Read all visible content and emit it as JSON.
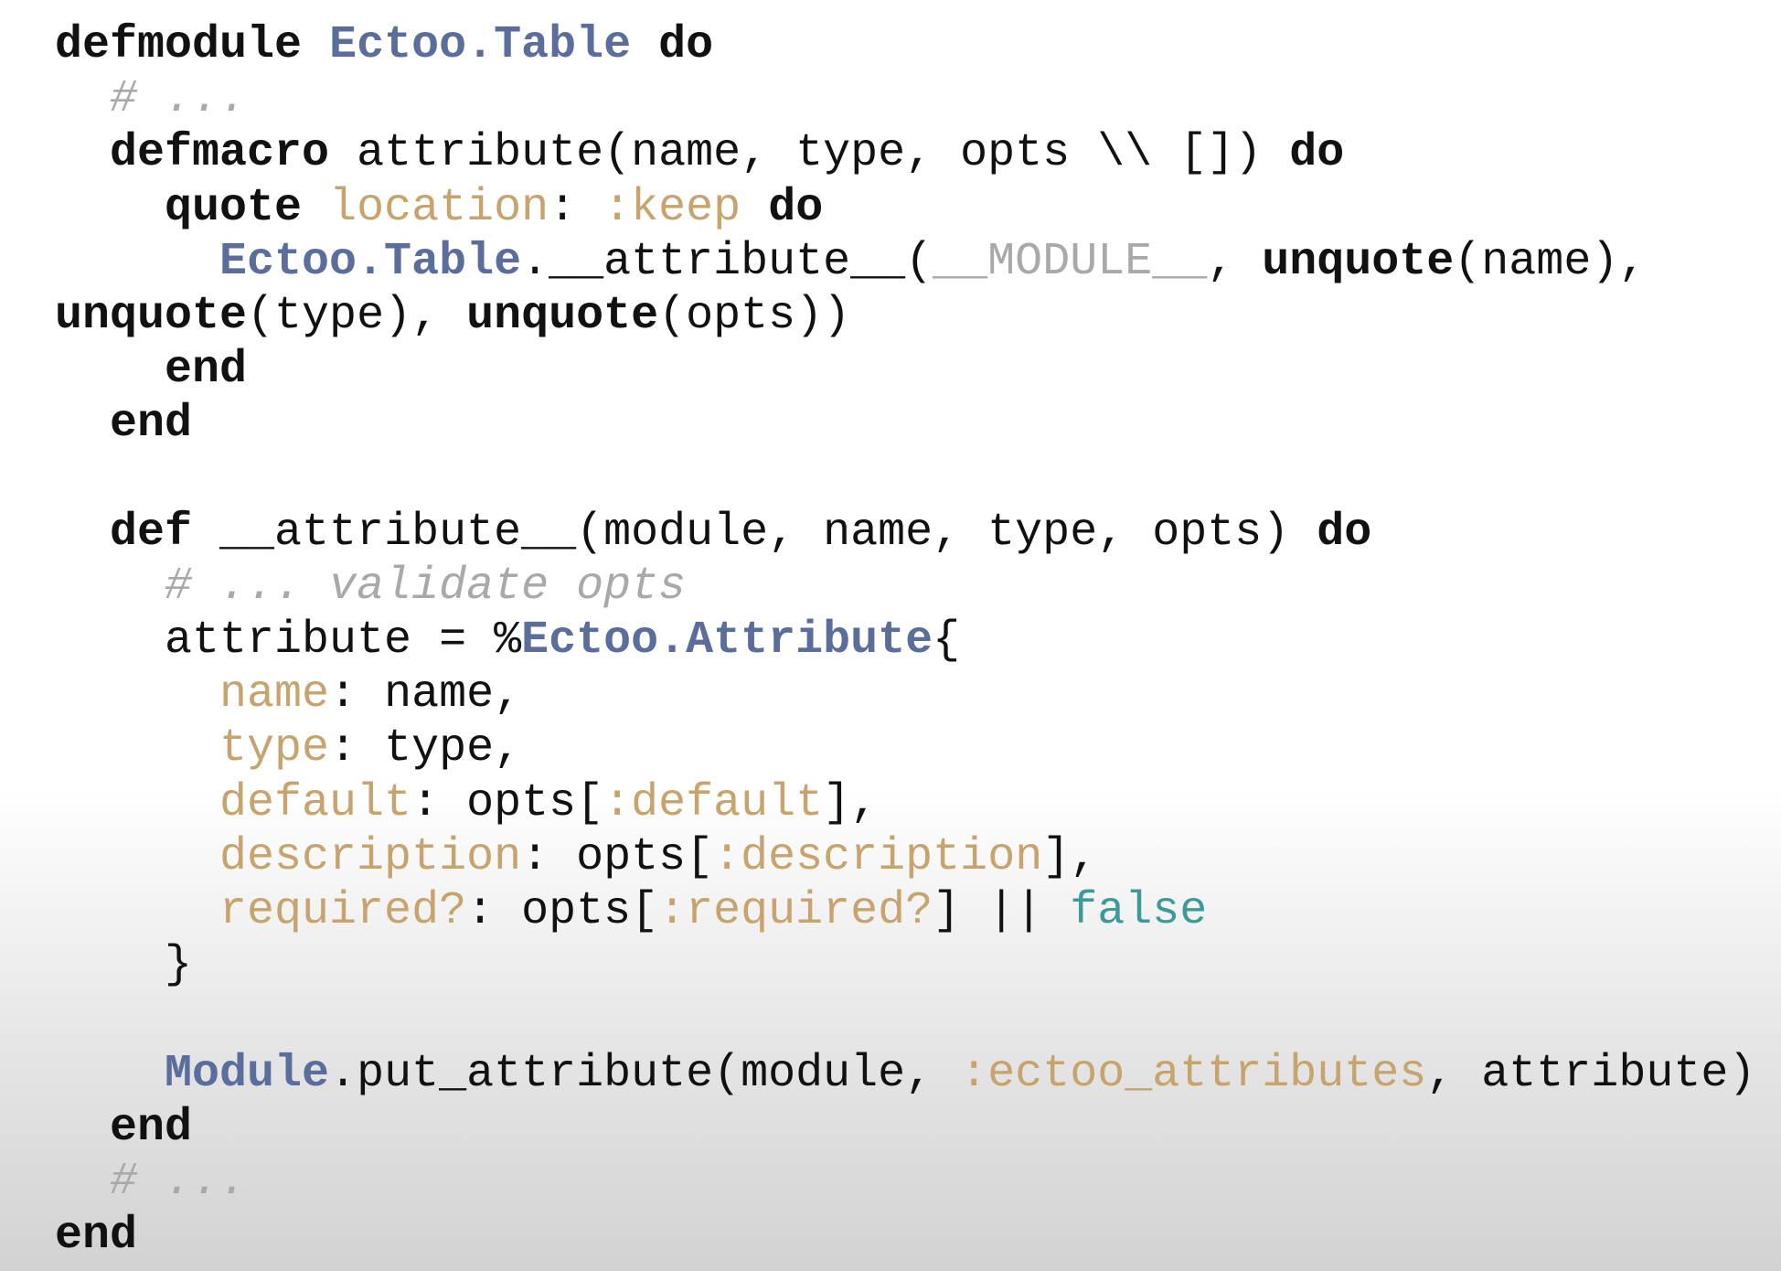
{
  "slide": {
    "language": "Elixir",
    "colors": {
      "background": "#ffffff",
      "keyword": "#111111",
      "module": "#5b6d9a",
      "atom": "#c7a36e",
      "comment": "#a9a9a9",
      "boolean": "#3d9a9b"
    },
    "lines": [
      [
        [
          "keyword",
          "defmodule"
        ],
        [
          "plain",
          " "
        ],
        [
          "module",
          "Ectoo.Table"
        ],
        [
          "plain",
          " "
        ],
        [
          "keyword",
          "do"
        ]
      ],
      [
        [
          "plain",
          "  "
        ],
        [
          "comment",
          "# ..."
        ]
      ],
      [
        [
          "plain",
          "  "
        ],
        [
          "keyword",
          "defmacro"
        ],
        [
          "plain",
          " attribute(name, type, opts \\\\ []) "
        ],
        [
          "keyword",
          "do"
        ]
      ],
      [
        [
          "plain",
          "    "
        ],
        [
          "keyword",
          "quote"
        ],
        [
          "plain",
          " "
        ],
        [
          "atom",
          "location"
        ],
        [
          "plain",
          ": "
        ],
        [
          "atom",
          ":keep"
        ],
        [
          "plain",
          " "
        ],
        [
          "keyword",
          "do"
        ]
      ],
      [
        [
          "plain",
          "      "
        ],
        [
          "module",
          "Ectoo.Table"
        ],
        [
          "plain",
          ".__attribute__("
        ],
        [
          "dim",
          "__MODULE__"
        ],
        [
          "plain",
          ", "
        ],
        [
          "keyword",
          "unquote"
        ],
        [
          "plain",
          "(name),"
        ]
      ],
      [
        [
          "keyword",
          "unquote"
        ],
        [
          "plain",
          "(type), "
        ],
        [
          "keyword",
          "unquote"
        ],
        [
          "plain",
          "(opts))"
        ]
      ],
      [
        [
          "plain",
          "    "
        ],
        [
          "keyword",
          "end"
        ]
      ],
      [
        [
          "plain",
          "  "
        ],
        [
          "keyword",
          "end"
        ]
      ],
      [],
      [
        [
          "plain",
          "  "
        ],
        [
          "keyword",
          "def"
        ],
        [
          "plain",
          " __attribute__(module, name, type, opts) "
        ],
        [
          "keyword",
          "do"
        ]
      ],
      [
        [
          "plain",
          "    "
        ],
        [
          "comment",
          "# ... validate opts"
        ]
      ],
      [
        [
          "plain",
          "    attribute = %"
        ],
        [
          "module",
          "Ectoo.Attribute"
        ],
        [
          "plain",
          "{"
        ]
      ],
      [
        [
          "plain",
          "      "
        ],
        [
          "atom",
          "name"
        ],
        [
          "plain",
          ": name,"
        ]
      ],
      [
        [
          "plain",
          "      "
        ],
        [
          "atom",
          "type"
        ],
        [
          "plain",
          ": type,"
        ]
      ],
      [
        [
          "plain",
          "      "
        ],
        [
          "atom",
          "default"
        ],
        [
          "plain",
          ": opts["
        ],
        [
          "atom",
          ":default"
        ],
        [
          "plain",
          "],"
        ]
      ],
      [
        [
          "plain",
          "      "
        ],
        [
          "atom",
          "description"
        ],
        [
          "plain",
          ": opts["
        ],
        [
          "atom",
          ":description"
        ],
        [
          "plain",
          "],"
        ]
      ],
      [
        [
          "plain",
          "      "
        ],
        [
          "atom",
          "required?"
        ],
        [
          "plain",
          ": opts["
        ],
        [
          "atom",
          ":required?"
        ],
        [
          "plain",
          "] || "
        ],
        [
          "bool",
          "false"
        ]
      ],
      [
        [
          "plain",
          "    }"
        ]
      ],
      [],
      [
        [
          "plain",
          "    "
        ],
        [
          "module",
          "Module"
        ],
        [
          "plain",
          ".put_attribute(module, "
        ],
        [
          "atom",
          ":ectoo_attributes"
        ],
        [
          "plain",
          ", attribute)"
        ]
      ],
      [
        [
          "plain",
          "  "
        ],
        [
          "keyword",
          "end"
        ]
      ],
      [
        [
          "plain",
          "  "
        ],
        [
          "comment",
          "# ..."
        ]
      ],
      [
        [
          "keyword",
          "end"
        ]
      ]
    ]
  }
}
